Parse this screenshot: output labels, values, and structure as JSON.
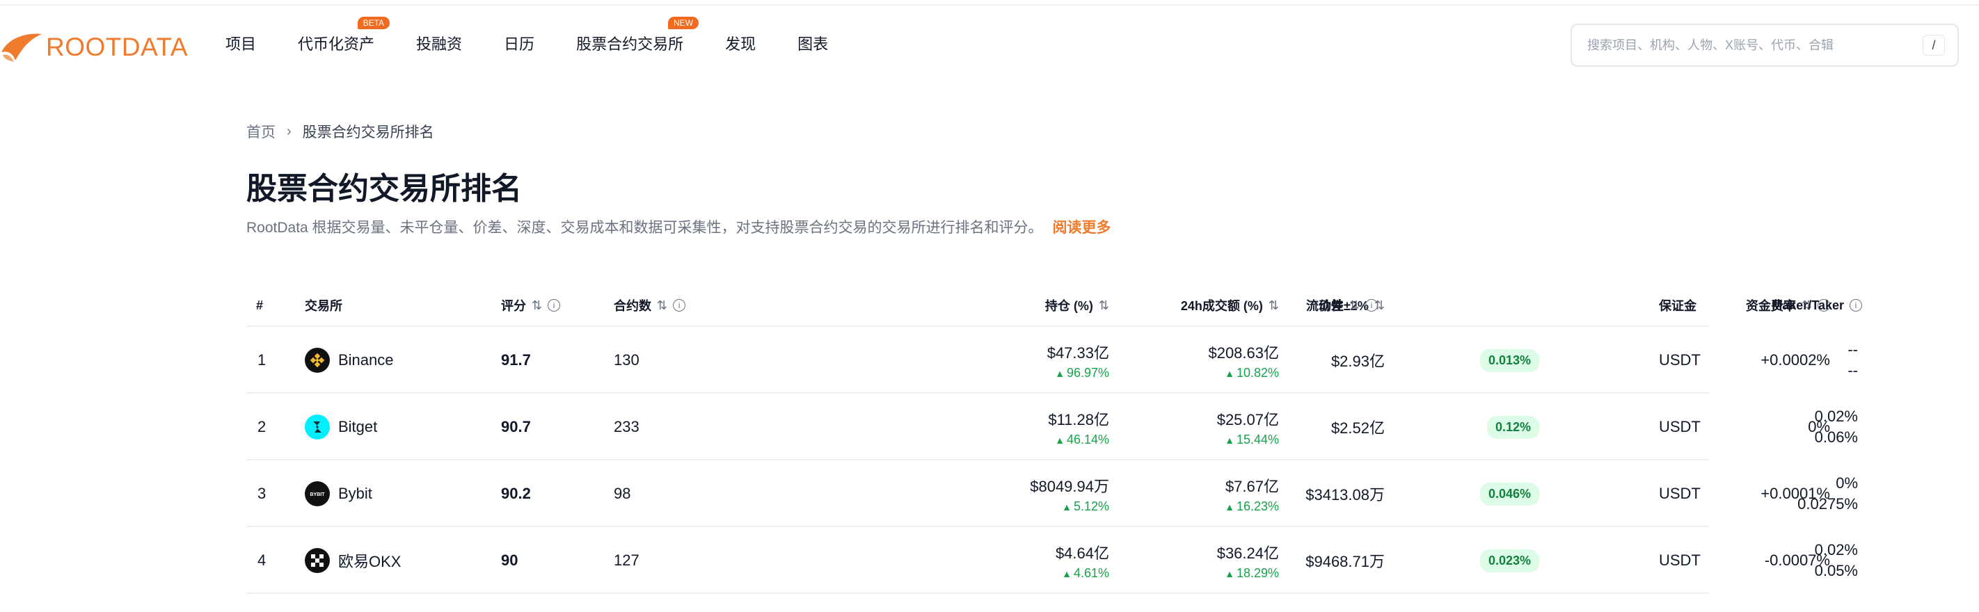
{
  "header": {
    "logo_text": "ROOTDATA",
    "nav": [
      {
        "label": "项目",
        "badge": ""
      },
      {
        "label": "代币化资产",
        "badge": "BETA"
      },
      {
        "label": "投融资",
        "badge": ""
      },
      {
        "label": "日历",
        "badge": ""
      },
      {
        "label": "股票合约交易所",
        "badge": "NEW"
      },
      {
        "label": "发现",
        "badge": ""
      },
      {
        "label": "图表",
        "badge": ""
      }
    ],
    "search": {
      "placeholder": "搜索项目、机构、人物、X账号、代币、合辑",
      "shortcut": "/"
    }
  },
  "breadcrumb": {
    "home": "首页",
    "current": "股票合约交易所排名"
  },
  "page": {
    "title": "股票合约交易所排名",
    "description": "RootData 根据交易量、未平仓量、价差、深度、交易成本和数据可采集性，对支持股票合约交易的交易所进行排名和评分。",
    "read_more": "阅读更多"
  },
  "table": {
    "columns": {
      "rank": "#",
      "exchange": "交易所",
      "score": "评分",
      "contracts": "合约数",
      "open_interest": "持仓 (%)",
      "volume": "24h成交额 (%)",
      "liquidity": "流动性±2%",
      "spread": "价差",
      "funding": "资金费率",
      "maker_taker": "Maker/Taker",
      "margin": "保证金"
    },
    "rows": [
      {
        "rank": "1",
        "name": "Binance",
        "logo": "binance-logo-icon",
        "logo_color": "#f3ba2f",
        "score": "91.7",
        "contracts": "130",
        "oi": "$47.33亿",
        "oi_change": "96.97%",
        "vol": "$208.63亿",
        "vol_change": "10.82%",
        "liquidity": "$2.93亿",
        "spread": "0.013%",
        "funding": "+0.0002%",
        "maker": "--",
        "taker": "--",
        "margin": "USDT"
      },
      {
        "rank": "2",
        "name": "Bitget",
        "logo": "bitget-logo-icon",
        "logo_color": "#1da2b4",
        "score": "90.7",
        "contracts": "233",
        "oi": "$11.28亿",
        "oi_change": "46.14%",
        "vol": "$25.07亿",
        "vol_change": "15.44%",
        "liquidity": "$2.52亿",
        "spread": "0.12%",
        "funding": "0%",
        "maker": "0.02%",
        "taker": "0.06%",
        "margin": "USDT"
      },
      {
        "rank": "3",
        "name": "Bybit",
        "logo": "bybit-logo-icon",
        "logo_color": "#000000",
        "score": "90.2",
        "contracts": "98",
        "oi": "$8049.94万",
        "oi_change": "5.12%",
        "vol": "$7.67亿",
        "vol_change": "16.23%",
        "liquidity": "$3413.08万",
        "spread": "0.046%",
        "funding": "+0.0001%",
        "maker": "0%",
        "taker": "0.0275%",
        "margin": "USDT"
      },
      {
        "rank": "4",
        "name": "欧易OKX",
        "logo": "okx-logo-icon",
        "logo_color": "#000000",
        "score": "90",
        "contracts": "127",
        "oi": "$4.64亿",
        "oi_change": "4.61%",
        "vol": "$36.24亿",
        "vol_change": "18.29%",
        "liquidity": "$9468.71万",
        "spread": "0.023%",
        "funding": "-0.0007%",
        "maker": "0.02%",
        "taker": "0.05%",
        "margin": "USDT"
      }
    ]
  },
  "colors": {
    "accent": "#f07b2c",
    "positive": "#16a34a",
    "pill_bg": "#dcfce7"
  }
}
